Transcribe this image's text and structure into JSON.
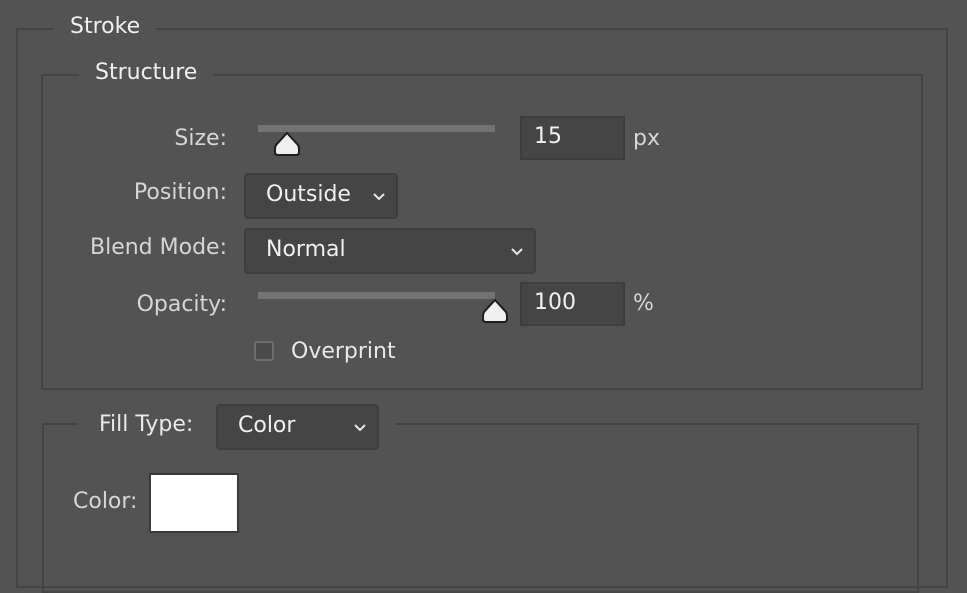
{
  "stroke": {
    "legend": "Stroke",
    "structure": {
      "legend": "Structure",
      "size": {
        "label": "Size:",
        "value": "15",
        "unit": "px",
        "slider_fraction": 0.08
      },
      "position": {
        "label": "Position:",
        "selected": "Outside"
      },
      "blend_mode": {
        "label": "Blend Mode:",
        "selected": "Normal"
      },
      "opacity": {
        "label": "Opacity:",
        "value": "100",
        "unit": "%",
        "slider_fraction": 1.0
      },
      "overprint": {
        "label": "Overprint",
        "checked": false
      }
    },
    "fill_type": {
      "label": "Fill Type:",
      "selected": "Color",
      "color": {
        "label": "Color:",
        "value": "#ffffff"
      }
    }
  }
}
